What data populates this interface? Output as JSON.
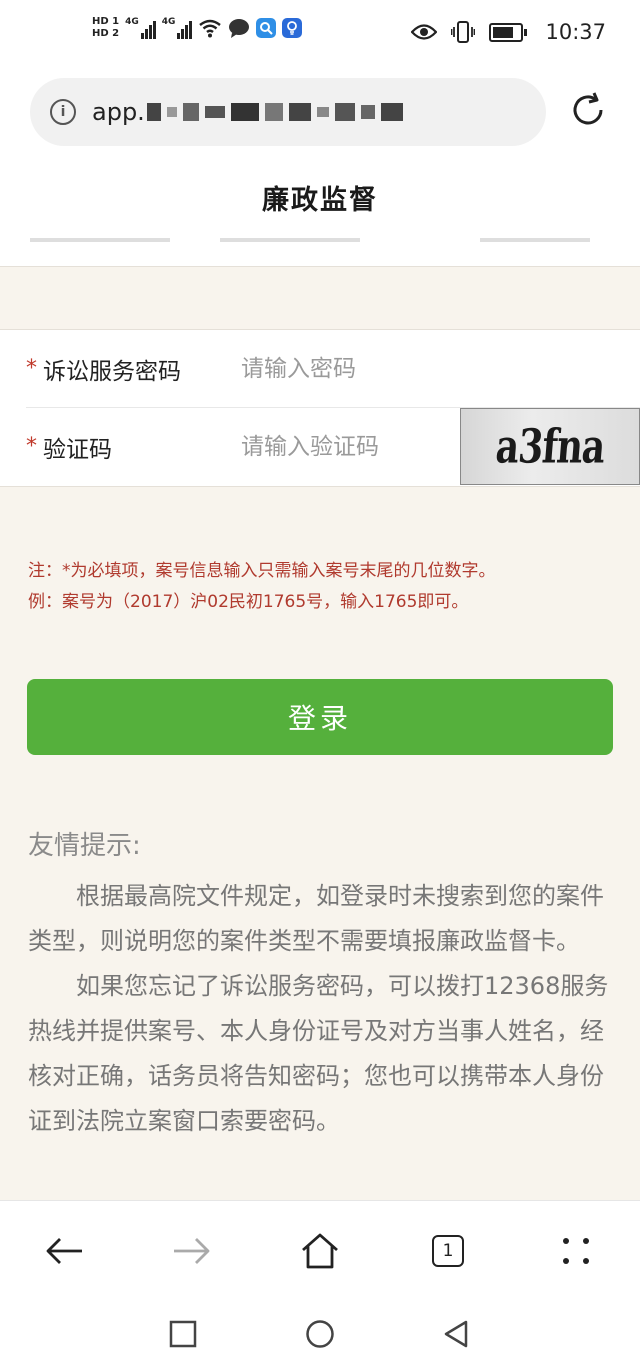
{
  "status_bar": {
    "hd1": "HD 1",
    "hd2": "HD 2",
    "network1": "4G",
    "network2": "4G",
    "icons": [
      "wifi-icon",
      "message-icon",
      "search-app-icon",
      "bulb-app-icon",
      "eye-icon",
      "vibrate-icon",
      "battery-icon"
    ],
    "time": "10:37"
  },
  "address_bar": {
    "url_prefix": "app."
  },
  "page": {
    "title": "廉政监督"
  },
  "form": {
    "password_label": "诉讼服务密码",
    "password_placeholder": "请输入密码",
    "captcha_label": "验证码",
    "captcha_placeholder": "请输入验证码",
    "captcha_text": "a3fna",
    "required_mark": "*"
  },
  "note": {
    "line1": "注：*为必填项，案号信息输入只需输入案号末尾的几位数字。",
    "line2": "例：案号为（2017）沪02民初1765号，输入1765即可。"
  },
  "login": {
    "label": "登录",
    "color": "#55b03c"
  },
  "tips": {
    "title": "友情提示:",
    "paragraph1": "根据最高院文件规定，如登录时未搜索到您的案件类型，则说明您的案件类型不需要填报廉政监督卡。",
    "paragraph2": "如果您忘记了诉讼服务密码，可以拨打12368服务热线并提供案号、本人身份证号及对方当事人姓名，经核对正确，话务员将告知密码；您也可以携带本人身份证到法院立案窗口索要密码。"
  },
  "browser_nav": {
    "tab_count": "1"
  }
}
